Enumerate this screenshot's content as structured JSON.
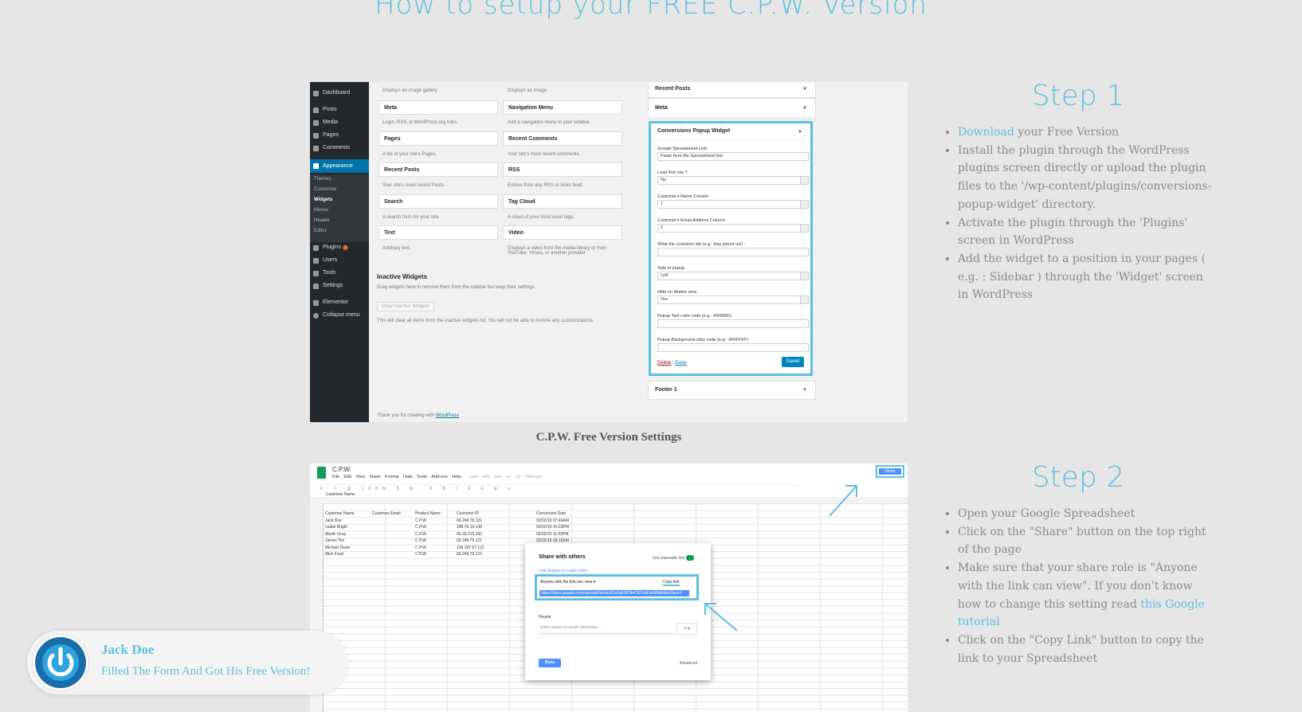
{
  "page": {
    "heading": "How to setup your FREE C.P.W. Version",
    "accent_color": "#5bbfe0"
  },
  "wp_screenshot": {
    "menu": [
      "Dashboard",
      "Posts",
      "Media",
      "Pages",
      "Comments",
      "Appearance",
      "Plugins",
      "Users",
      "Tools",
      "Settings",
      "Elementor",
      "Collapse menu"
    ],
    "appearance_submenu": [
      "Themes",
      "Customize",
      "Widgets",
      "Menus",
      "Header",
      "Editor"
    ],
    "plugins_badge": "1",
    "widgets_left": [
      {
        "title": "Meta",
        "desc": "Login, RSS, & WordPress.org links."
      },
      {
        "title": "Pages",
        "desc": "A list of your site's Pages."
      },
      {
        "title": "Recent Posts",
        "desc": "Your site's most recent Posts."
      },
      {
        "title": "Search",
        "desc": "A search form for your site."
      },
      {
        "title": "Text",
        "desc": "Arbitrary text."
      }
    ],
    "widgets_right": [
      {
        "title": "Navigation Menu",
        "desc": "Add a navigation menu to your sidebar."
      },
      {
        "title": "Recent Comments",
        "desc": "Your site's most recent comments."
      },
      {
        "title": "RSS",
        "desc": "Entries from any RSS or Atom feed."
      },
      {
        "title": "Tag Cloud",
        "desc": "A cloud of your most used tags."
      },
      {
        "title": "Video",
        "desc": "Displays a video from the media library or from YouTube, Vimeo, or another provider."
      }
    ],
    "top_desc_left": "Displays an image gallery.",
    "top_desc_right": "Displays an image.",
    "inactive_title": "Inactive Widgets",
    "inactive_desc": "Drag widgets here to remove them from the sidebar but keep their settings.",
    "clear_button": "Clear Inactive Widgets",
    "clear_note": "This will clear all items from the inactive widgets list. You will not be able to restore any customizations.",
    "footer_credit_prefix": "Thank you for creating with ",
    "footer_credit_link": "WordPress",
    "sidebar_panels": [
      "Recent Posts",
      "Meta"
    ],
    "cpw_widget": {
      "title": "Conversions Popup Widget",
      "fields": [
        {
          "label": "Google Spreadsheet Link:",
          "value": "Paste here the Spreadsheet link",
          "select": false
        },
        {
          "label": "Load first row ?",
          "value": "No",
          "select": true
        },
        {
          "label": "Customer's Name Column",
          "value": "1",
          "select": true
        },
        {
          "label": "Customer's Email Address Column",
          "value": "2",
          "select": true
        },
        {
          "label": "What the customer did (e.g.: Has joined us!) :",
          "value": "",
          "select": false
        },
        {
          "label": "Side of popup",
          "value": "Left",
          "select": true
        },
        {
          "label": "Hide on Mobile view",
          "value": "Yes",
          "select": true
        },
        {
          "label": "Popup Text color code (e.g.: #000000)",
          "value": "",
          "select": false
        },
        {
          "label": "Popup Background color code (e.g.: #FFFFFF)",
          "value": "",
          "select": false
        }
      ],
      "delete_link": "Delete",
      "done_link": "Done",
      "saved_button": "Saved"
    },
    "footer_panel": "Footer 1"
  },
  "caption1": "C.P.W. Free Version Settings",
  "step1": {
    "title": "Step 1",
    "download_link": "Download",
    "item1_rest": " your Free Version",
    "item2": "Install the plugin through the WordPress plugins screen directly or upload the plugin files to the '/wp-content/plugins/conversions-popup-widget' directory.",
    "item3": "Activate the plugin through the 'Plugins' screen in WordPress",
    "item4": "Add the widget to a position in your pages ( e.g. : Sidebar ) through the 'Widget' screen in WordPress"
  },
  "sheet_screenshot": {
    "doc_title": "C.P.W.",
    "menu": "File Edit View Insert Format Data Tools Add-ons Help",
    "last_edit": "Last edit was on 10 February",
    "share_button": "Share",
    "cell_ref": "Customer Name",
    "headers": [
      "Customer Name",
      "Customer Email",
      "Product Name",
      "Customer IP",
      "Conversion Date"
    ],
    "rows": [
      [
        "Jack Doe",
        "",
        "C.P.W.",
        "66.249.76.121",
        "02/02/16 07:46AM"
      ],
      [
        "Isabel Bright",
        "",
        "C.P.W.",
        "188.76.10.148",
        "02/02/16 10:23PM"
      ],
      [
        "Martin Grey",
        "",
        "C.P.W.",
        "66.30.210.242",
        "02/02/16 11:43PM"
      ],
      [
        "James Tim",
        "",
        "C.P.W.",
        "66.249.76.121",
        "02/02/16 09:15AM"
      ],
      [
        "Michael Down",
        "",
        "C.P.W.",
        "139.197.57.112",
        ""
      ],
      [
        "Mick Feed",
        "",
        "C.P.W.",
        "66.249.76.121",
        ""
      ]
    ],
    "dialog": {
      "title": "Share with others",
      "get_link": "Get shareable link",
      "link_sharing": "Link sharing on   Learn more",
      "access": "Anyone with the link can view",
      "copy_link": "Copy link",
      "url": "https://docs.google.com/spreadsheets/d/1oFg6ZF3hrCECxt6JwIWkM4wzRscc4",
      "people_label": "People",
      "people_placeholder": "Enter names or email addresses...",
      "done": "Done",
      "advanced": "Advanced"
    }
  },
  "step2": {
    "title": "Step 2",
    "item1": "Open your Google Spreadsheet",
    "item2": "Click on the \"Share\" button on the top right of the page",
    "item3_prefix": "Make sure that your share role is \"Anyone with the link can view\". If you don't know how to change this setting read ",
    "item3_link": "this Google tutorial",
    "item4": "Click on the \"Copy Link\" button to copy the link to your Spreadsheet"
  },
  "popup": {
    "name": "Jack Doe",
    "message": "Filled The Form And Got His Free Version!",
    "avatar_icon": "power-icon"
  }
}
